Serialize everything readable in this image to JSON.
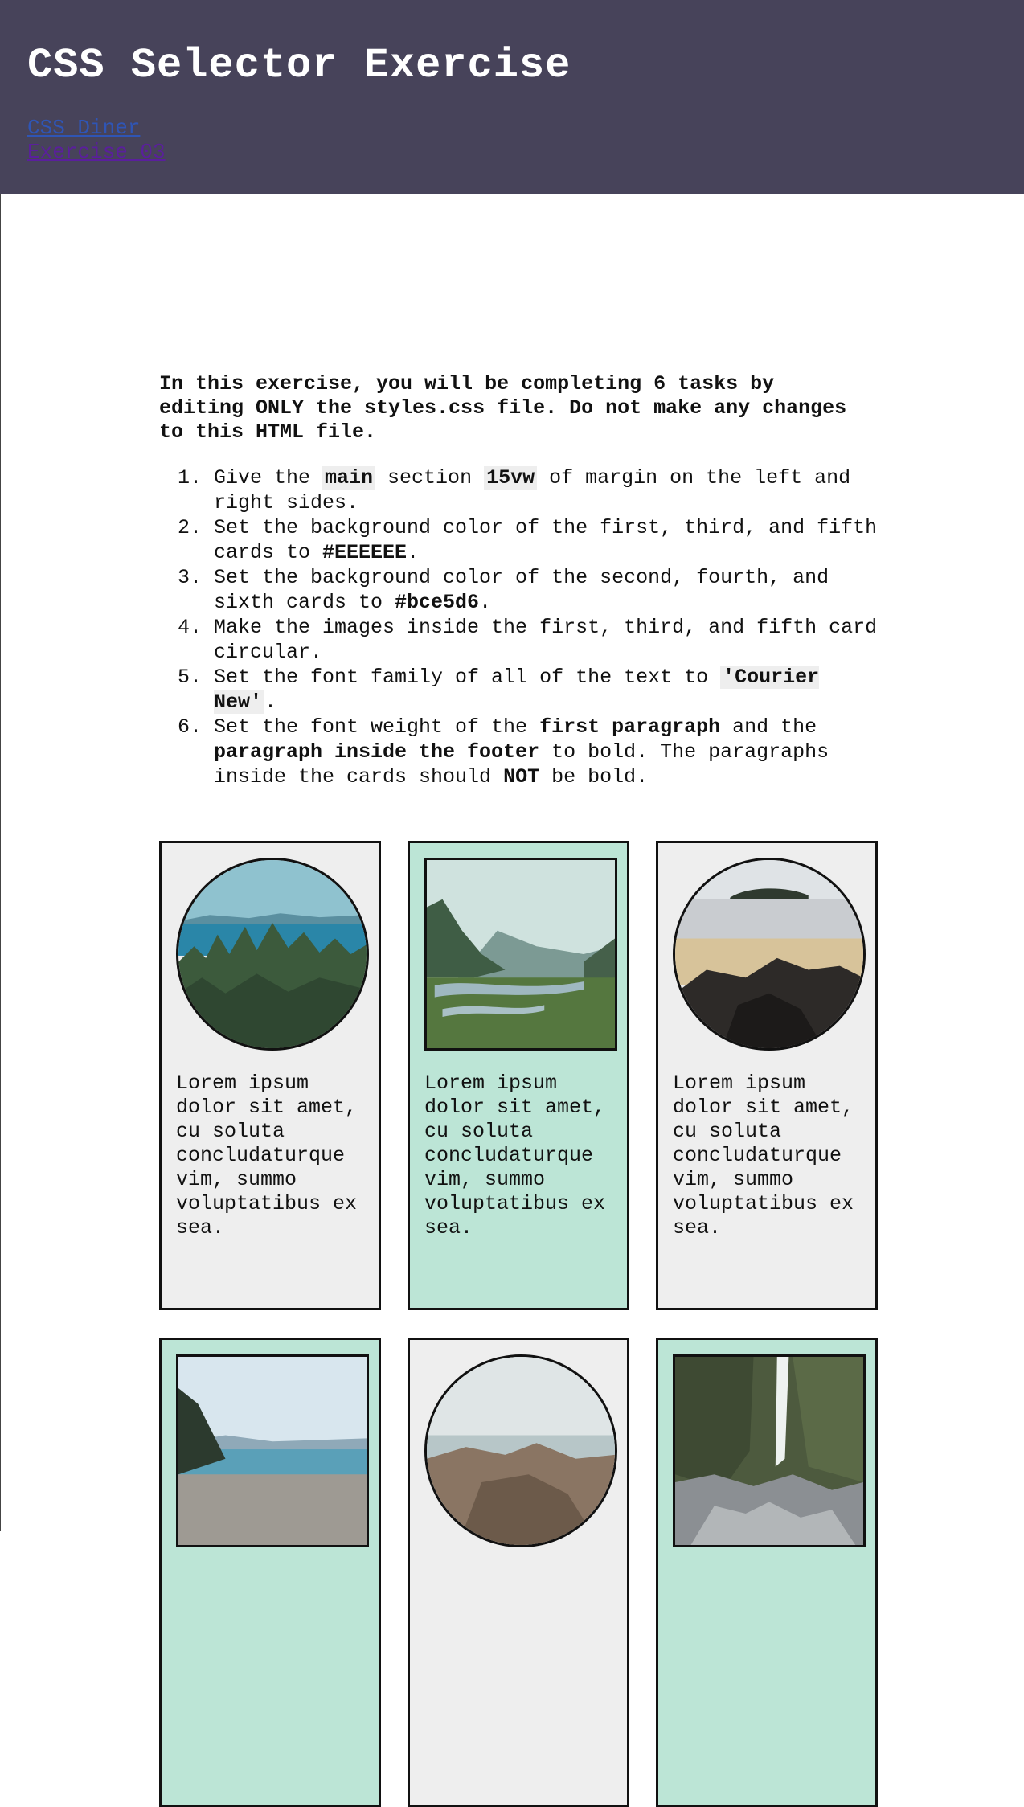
{
  "header": {
    "title": "CSS Selector Exercise",
    "links": [
      "CSS Diner",
      "Exercise 03"
    ]
  },
  "main": {
    "intro": "In this exercise, you will be completing 6 tasks by editing ONLY the styles.css file. Do not make any changes to this HTML file.",
    "tasks": [
      {
        "a": "Give the ",
        "c1": "main",
        "b": " section ",
        "c2": "15vw",
        "d": " of margin on the left and right sides."
      },
      {
        "a": "Set the background color of the first, third, and fifth cards to ",
        "b1": "#EEEEEE",
        "d": "."
      },
      {
        "a": "Set the background color of the second, fourth, and sixth cards to ",
        "b1": "#bce5d6",
        "d": "."
      },
      {
        "a": "Make the images inside the first, third, and fifth card circular."
      },
      {
        "a": "Set the font family of all of the text to ",
        "c1": "'Courier New'",
        "d": "."
      },
      {
        "a": "Set the font weight of the ",
        "b1": "first paragraph",
        "b": " and the ",
        "b2": "paragraph inside the footer",
        "c": " to bold. The paragraphs inside the cards should ",
        "b3": "NOT",
        "d": " be bold."
      }
    ],
    "cards": [
      {
        "text": "Lorem ipsum dolor sit amet, cu soluta concludaturque vim, summo voluptatibus ex sea.",
        "image": "forest-lake-photo"
      },
      {
        "text": "Lorem ipsum dolor sit amet, cu soluta concludaturque vim, summo voluptatibus ex sea.",
        "image": "river-valley-photo"
      },
      {
        "text": "Lorem ipsum dolor sit amet, cu soluta concludaturque vim, summo voluptatibus ex sea.",
        "image": "beach-rocks-photo"
      },
      {
        "text": "",
        "image": "pebble-shore-photo"
      },
      {
        "text": "",
        "image": "rocky-coast-photo"
      },
      {
        "text": "",
        "image": "waterfall-photo"
      }
    ]
  },
  "colors": {
    "header_bg": "#47435a",
    "card_grey": "#EEEEEE",
    "card_mint": "#bce5d6"
  }
}
